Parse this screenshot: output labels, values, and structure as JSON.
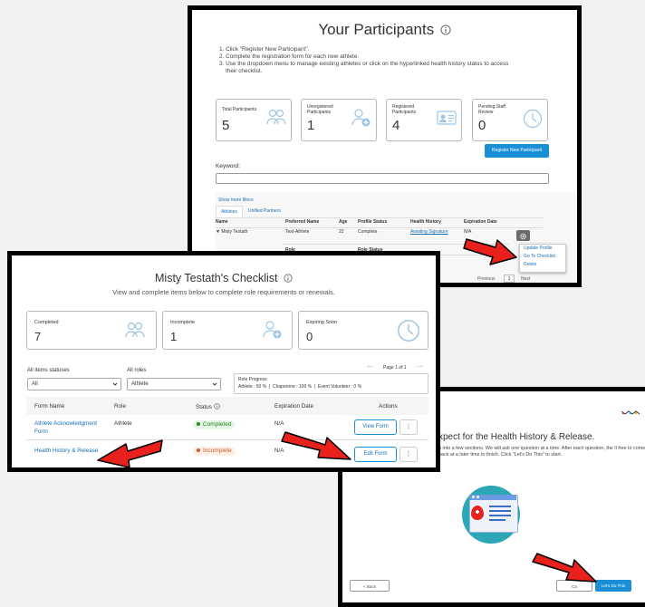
{
  "participants": {
    "title": "Your Participants",
    "info_icon": "info-circle-icon",
    "instructions": [
      "1. Click \"Register New Participant\".",
      "2. Complete the registration form for each new athlete.",
      "3. Use the dropdown menu to manage existing athletes or click on the hyperlinked health history status to access",
      "their checklist."
    ],
    "stats": [
      {
        "label": "Total Participants",
        "value": "5",
        "icon": "people-icon"
      },
      {
        "label": "Unregistered Participants",
        "value": "1",
        "icon": "person-add-icon"
      },
      {
        "label": "Registered Participants",
        "value": "4",
        "icon": "id-card-icon"
      },
      {
        "label": "Pending Staff Review",
        "value": "0",
        "icon": "clock-icon"
      }
    ],
    "register_button": "Register New Participant",
    "keyword_label": "Keyword:",
    "keyword_value": "",
    "show_more_filters": "Show more filters",
    "tabs": [
      "Athletes",
      "Unified Partners"
    ],
    "columns": [
      "Name",
      "Preferred Name",
      "Age",
      "Profile Status",
      "Health History",
      "Expiration Date"
    ],
    "row": {
      "name": "▼ Misty Testath",
      "preferred": "Test-Athlete",
      "age": "22",
      "profile_status": "Complete",
      "health_history": "Awaiting Signature",
      "expiration": "N/A"
    },
    "subtable_columns": [
      "Role",
      "Role Status"
    ],
    "dropdown_items": [
      "Update Profile",
      "Go To Checklist",
      "Delete"
    ],
    "pagination": {
      "previous": "Previous",
      "page": "1",
      "next": "Next"
    }
  },
  "checklist": {
    "title": "Misty Testath's Checklist",
    "info_icon": "info-circle-icon",
    "subtitle": "View and complete items below to complete role requirements or renewals.",
    "stats": [
      {
        "label": "Completed",
        "value": "7",
        "icon": "people-icon"
      },
      {
        "label": "Incomplete",
        "value": "1",
        "icon": "person-add-icon"
      },
      {
        "label": "Expiring Soon",
        "value": "0",
        "icon": "clock-icon"
      }
    ],
    "filter_status_label": "All items statuses",
    "filter_status_value": "All",
    "filter_role_label": "All roles",
    "filter_role_value": "Athlete",
    "page_indicator": "Page 1 of 1",
    "role_progress_label": "Role Progress",
    "role_progress_value": "Athlete : 50 %  |  Chaperone : 100 %  |  Event Volunteer : 0 %",
    "columns": [
      "Form Name",
      "Role",
      "Status",
      "Expiration Date",
      "Actions"
    ],
    "rows": [
      {
        "form": "Athlete Acknowledgment Form",
        "role": "Athlete",
        "status": "Completed",
        "expiration": "N/A",
        "action": "View Form"
      },
      {
        "form": "Health History & Release",
        "role": "",
        "status": "Incomplete",
        "expiration": "N/A",
        "action": "Edit Form"
      }
    ]
  },
  "health": {
    "heading": "xpect for the Health History & Release.",
    "body": "n into a few sections. We will ask one question at a time. After each question, the  ll free to come back at a later time to finish. Click \"Let's Do This\" to start.",
    "back_button": "< Back",
    "cancel_button": "Ca",
    "start_button": "Let's Do This",
    "illustration": "medical-form-illustration"
  },
  "colors": {
    "accent": "#1a8fd8",
    "arrow_red": "#e8211c",
    "completed_green": "#2a8a2a",
    "incomplete_orange": "#c9602a"
  }
}
